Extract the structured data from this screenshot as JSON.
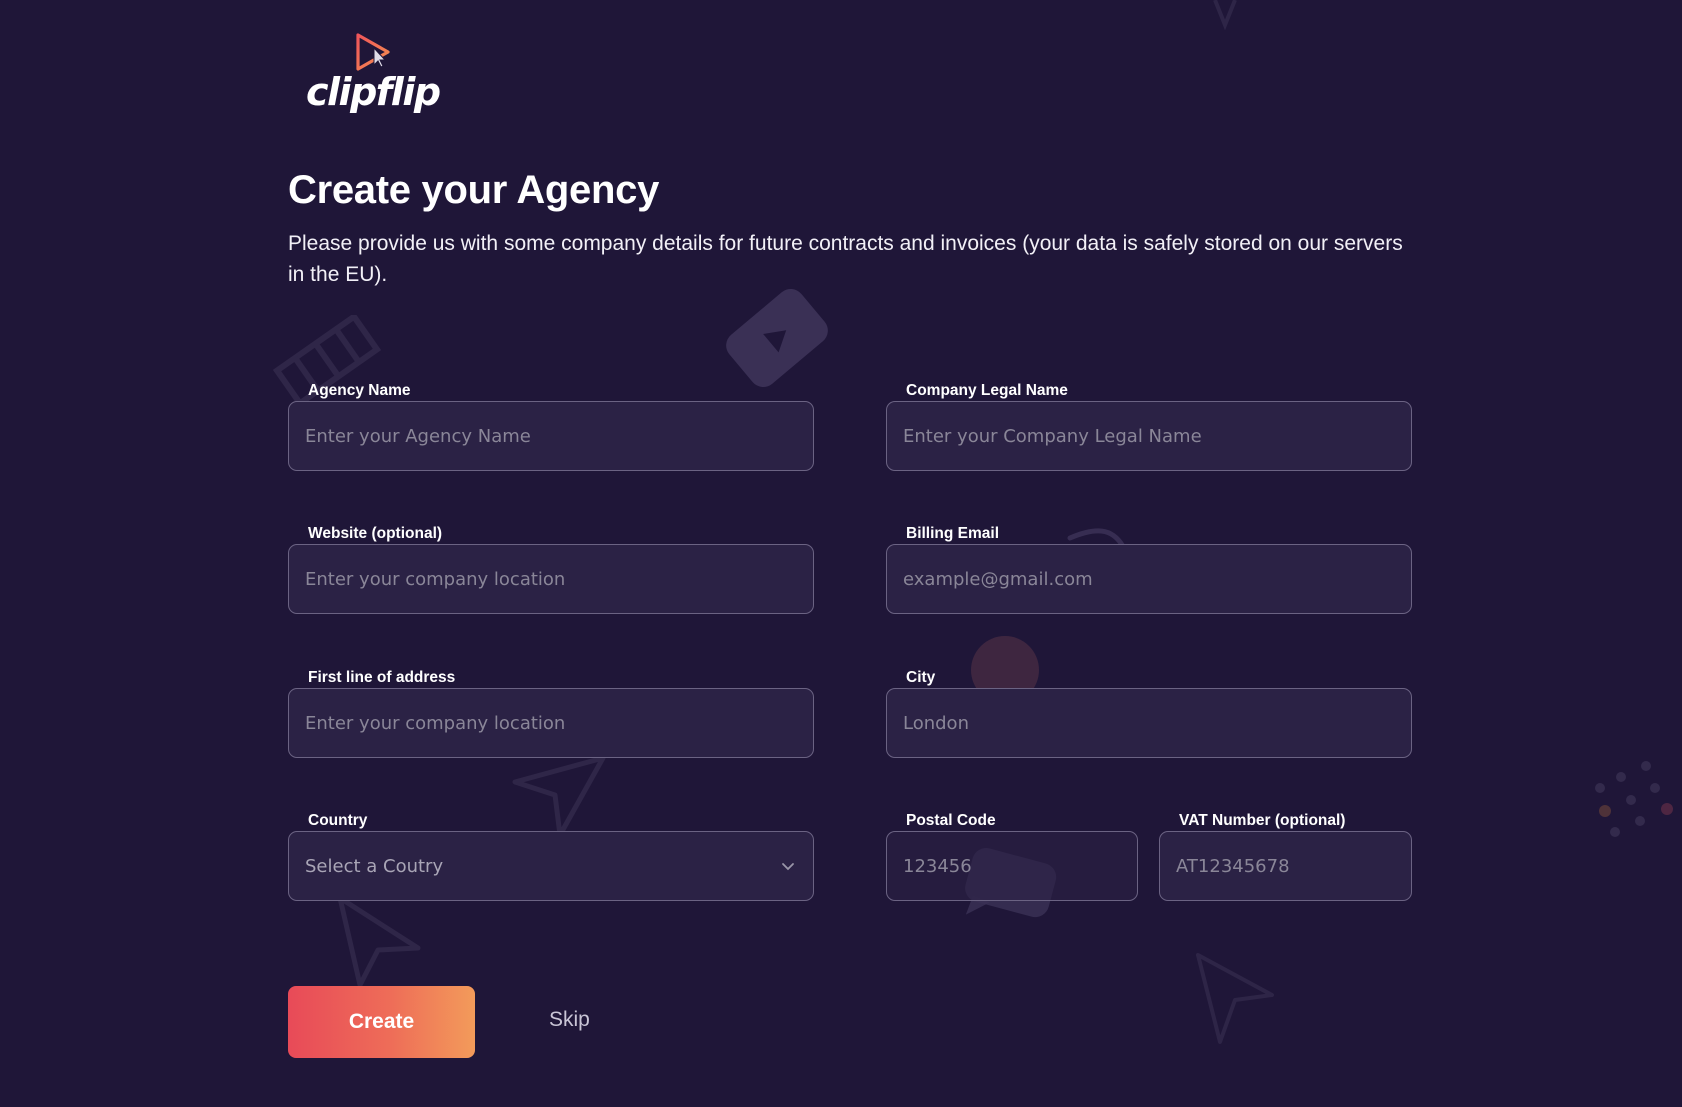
{
  "brand": {
    "name": "clipflip",
    "accent_start": "#e84a58",
    "accent_end": "#f39b5a",
    "background": "#1f1638"
  },
  "header": {
    "title": "Create your Agency",
    "subtitle": "Please provide us with some company details for future contracts and invoices (your data is safely stored on our servers in the EU)."
  },
  "form": {
    "agency_name": {
      "label": "Agency Name",
      "placeholder": "Enter your Agency Name",
      "value": ""
    },
    "company_legal_name": {
      "label": "Company Legal Name",
      "placeholder": "Enter your Company Legal Name",
      "value": ""
    },
    "website": {
      "label": "Website (optional)",
      "placeholder": "Enter your company location",
      "value": ""
    },
    "billing_email": {
      "label": "Billing Email",
      "placeholder": "example@gmail.com",
      "value": ""
    },
    "address_line1": {
      "label": "First line of address",
      "placeholder": "Enter your company location",
      "value": ""
    },
    "city": {
      "label": "City",
      "placeholder": "London",
      "value": ""
    },
    "country": {
      "label": "Country",
      "selected": "Select a Coutry",
      "icon": "chevron-down-icon"
    },
    "postal_code": {
      "label": "Postal Code",
      "placeholder": "123456",
      "value": ""
    },
    "vat_number": {
      "label": "VAT Number (optional)",
      "placeholder": "AT12345678",
      "value": ""
    }
  },
  "actions": {
    "create_label": "Create",
    "skip_label": "Skip"
  }
}
